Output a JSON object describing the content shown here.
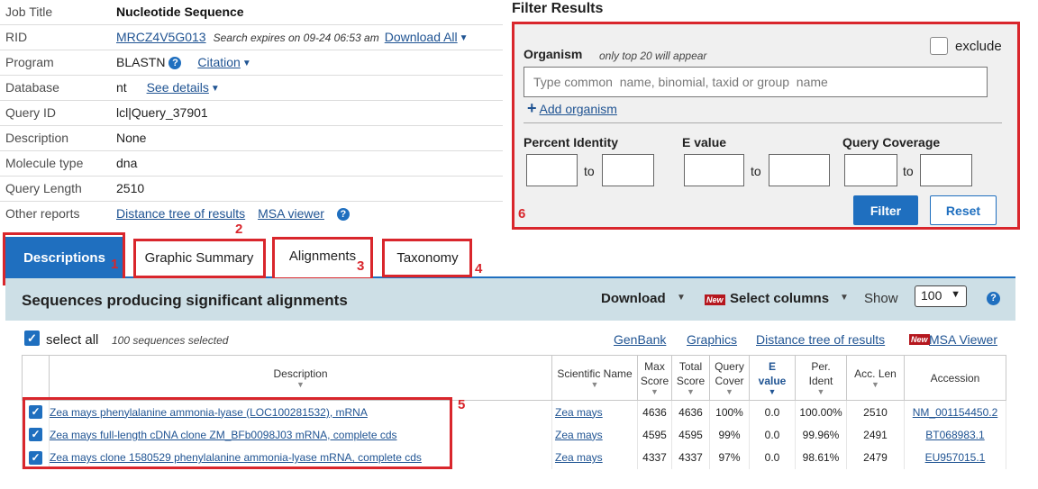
{
  "job": {
    "rows": [
      {
        "label": "Job Title",
        "value": "Nucleotide Sequence"
      },
      {
        "label": "RID",
        "value": "MRCZ4V5G013",
        "note": "Search expires on 09-24 06:53 am",
        "action": "Download All"
      },
      {
        "label": "Program",
        "value": "BLASTN",
        "action": "Citation"
      },
      {
        "label": "Database",
        "value": "nt",
        "action": "See details"
      },
      {
        "label": "Query ID",
        "value": "lcl|Query_37901"
      },
      {
        "label": "Description",
        "value": "None"
      },
      {
        "label": "Molecule type",
        "value": "dna"
      },
      {
        "label": "Query Length",
        "value": "2510"
      },
      {
        "label": "Other reports",
        "link1": "Distance tree of results",
        "link2": "MSA viewer"
      }
    ]
  },
  "filter": {
    "title": "Filter Results",
    "organism_label": "Organism",
    "organism_note": "only top 20 will appear",
    "exclude_label": "exclude",
    "organism_placeholder": "Type common  name, binomial, taxid or group  name",
    "add_organism": "Add organism",
    "percent_identity_label": "Percent Identity",
    "evalue_label": "E value",
    "query_coverage_label": "Query Coverage",
    "to_label": "to",
    "filter_button": "Filter",
    "reset_button": "Reset"
  },
  "annotations": [
    "1",
    "2",
    "3",
    "4",
    "5",
    "6"
  ],
  "tabs": [
    {
      "label": "Descriptions",
      "active": true
    },
    {
      "label": "Graphic Summary",
      "active": false
    },
    {
      "label": "Alignments",
      "active": false
    },
    {
      "label": "Taxonomy",
      "active": false
    }
  ],
  "results": {
    "title": "Sequences producing significant alignments",
    "download": "Download",
    "new_badge": "New",
    "select_columns": "Select columns",
    "show_label": "Show",
    "show_value": "100",
    "select_all": "select all",
    "selected_count": "100 sequences selected",
    "links": [
      "GenBank",
      "Graphics",
      "Distance tree of results",
      "MSA Viewer"
    ],
    "columns": {
      "description": "Description",
      "scientific_name": "Scientific Name",
      "max_score_1": "Max",
      "max_score_2": "Score",
      "total_score_1": "Total",
      "total_score_2": "Score",
      "query_cover_1": "Query",
      "query_cover_2": "Cover",
      "evalue_1": "E",
      "evalue_2": "value",
      "per_ident_1": "Per.",
      "per_ident_2": "Ident",
      "acc_len_1": "Acc. Len",
      "accession": "Accession"
    },
    "rows": [
      {
        "description": "Zea mays phenylalanine ammonia-lyase (LOC100281532), mRNA",
        "scientific_name": "Zea mays",
        "max_score": "4636",
        "total_score": "4636",
        "query_cover": "100%",
        "evalue": "0.0",
        "per_ident": "100.00%",
        "acc_len": "2510",
        "accession": "NM_001154450.2"
      },
      {
        "description": "Zea mays full-length cDNA clone ZM_BFb0098J03 mRNA, complete cds",
        "scientific_name": "Zea mays",
        "max_score": "4595",
        "total_score": "4595",
        "query_cover": "99%",
        "evalue": "0.0",
        "per_ident": "99.96%",
        "acc_len": "2491",
        "accession": "BT068983.1"
      },
      {
        "description": "Zea mays clone 1580529 phenylalanine ammonia-lyase mRNA, complete cds",
        "scientific_name": "Zea mays",
        "max_score": "4337",
        "total_score": "4337",
        "query_cover": "97%",
        "evalue": "0.0",
        "per_ident": "98.61%",
        "acc_len": "2479",
        "accession": "EU957015.1"
      }
    ]
  },
  "icons": [
    "help-icon",
    "chevron-down-icon",
    "plus-icon",
    "checkbox-icon",
    "sort-arrow-icon"
  ],
  "colors": {
    "primary": "#1f6fbf",
    "annotation_red": "#d9262c",
    "header_bg": "#cddfe6",
    "new_badge": "#b5171e"
  }
}
